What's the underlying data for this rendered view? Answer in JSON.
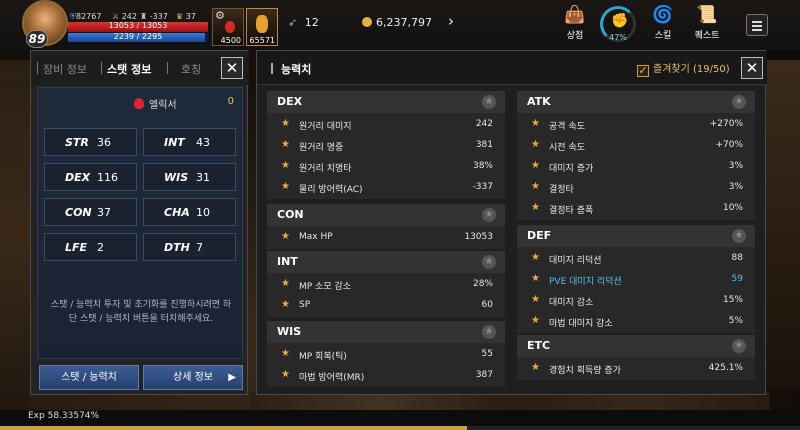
{
  "hud": {
    "level": "89",
    "stats": [
      {
        "icon": "shield-icon",
        "value": "82767"
      },
      {
        "icon": "sword-icon",
        "value": "242"
      },
      {
        "icon": "helmet-icon",
        "value": "-337"
      },
      {
        "icon": "trophy-icon",
        "value": "37"
      }
    ],
    "hp_text": "13053 / 13053",
    "hp_fraction": 1.0,
    "mp_text": "2239 / 2295",
    "mp_fraction": 0.9756,
    "potion1_count": "4500",
    "potion2_count": "65571",
    "wing_count": "12",
    "gold": "6,237,797",
    "menu": [
      {
        "label": "상점",
        "icon": "shop-bag-icon"
      },
      {
        "label": "스킬",
        "icon": "skill-icon"
      },
      {
        "label": "퀘스트",
        "icon": "quest-icon"
      }
    ],
    "ring_percent": "47%"
  },
  "left_panel": {
    "tabs": [
      "장비 정보",
      "스탯 정보",
      "호칭"
    ],
    "active_tab": 1,
    "elixir_label": "엘릭서",
    "elixir_value": "0",
    "stats": [
      {
        "k": "STR",
        "v": "36"
      },
      {
        "k": "INT",
        "v": "43"
      },
      {
        "k": "DEX",
        "v": "116"
      },
      {
        "k": "WIS",
        "v": "31"
      },
      {
        "k": "CON",
        "v": "37"
      },
      {
        "k": "CHA",
        "v": "10"
      },
      {
        "k": "LFE",
        "v": "2"
      },
      {
        "k": "DTH",
        "v": "7"
      }
    ],
    "hint": "스탯 / 능력치 투자 및 초기화를 진행하시려면 하단 스탯 / 능력치 버튼을 터치해주세요.",
    "btn_stat": "스탯 / 능력치",
    "btn_detail": "상세 정보"
  },
  "right_panel": {
    "title": "능력치",
    "favorite_label": "즐겨찾기 (19/50)",
    "sections": {
      "dex": {
        "title": "DEX",
        "rows": [
          {
            "n": "원거리 대미지",
            "v": "242"
          },
          {
            "n": "원거리 명중",
            "v": "381"
          },
          {
            "n": "원거리 치명타",
            "v": "38%"
          },
          {
            "n": "물리 방어력(AC)",
            "v": "-337"
          }
        ]
      },
      "con": {
        "title": "CON",
        "rows": [
          {
            "n": "Max HP",
            "v": "13053"
          }
        ]
      },
      "int": {
        "title": "INT",
        "rows": [
          {
            "n": "MP 소모 감소",
            "v": "28%"
          },
          {
            "n": "SP",
            "v": "60"
          }
        ]
      },
      "wis": {
        "title": "WIS",
        "rows": [
          {
            "n": "MP 회복(틱)",
            "v": "55"
          },
          {
            "n": "마법 방어력(MR)",
            "v": "387"
          }
        ]
      },
      "atk": {
        "title": "ATK",
        "rows": [
          {
            "n": "공격 속도",
            "v": "+270%"
          },
          {
            "n": "시전 속도",
            "v": "+70%"
          },
          {
            "n": "대미지 증가",
            "v": "3%"
          },
          {
            "n": "결정타",
            "v": "3%"
          },
          {
            "n": "결정타 증폭",
            "v": "10%"
          }
        ]
      },
      "def": {
        "title": "DEF",
        "rows": [
          {
            "n": "대미지 리덕션",
            "v": "88"
          },
          {
            "n": "PVE 대미지 리덕션",
            "v": "59"
          },
          {
            "n": "대미지 감소",
            "v": "15%"
          },
          {
            "n": "마법 대미지 감소",
            "v": "5%"
          }
        ]
      },
      "etc": {
        "title": "ETC",
        "rows": [
          {
            "n": "경험치 획득량 증가",
            "v": "425.1%"
          }
        ]
      }
    }
  },
  "bottom": {
    "exp_text": "Exp  58.33574%",
    "exp_fraction": 0.5834
  },
  "colors": {
    "highlight": "#4ec0ea",
    "star": "#f0a93a",
    "accent_gold": "#e8c06a"
  }
}
